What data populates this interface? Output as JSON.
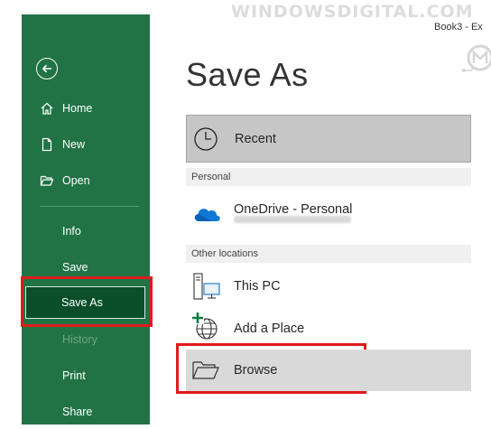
{
  "watermark": "WINDOWSDIGITAL.COM",
  "document_title": "Book3  -  Ex",
  "sidebar": {
    "items": [
      {
        "label": "Home"
      },
      {
        "label": "New"
      },
      {
        "label": "Open"
      },
      {
        "label": "Info"
      },
      {
        "label": "Save"
      },
      {
        "label": "Save As"
      },
      {
        "label": "History"
      },
      {
        "label": "Print"
      },
      {
        "label": "Share"
      }
    ]
  },
  "main": {
    "title": "Save As",
    "recent_label": "Recent",
    "personal_header": "Personal",
    "onedrive_label": "OneDrive - Personal",
    "other_header": "Other locations",
    "this_pc_label": "This PC",
    "add_place_label": "Add a Place",
    "browse_label": "Browse"
  },
  "colors": {
    "sidebar": "#217346",
    "selected": "#0b4f2a",
    "highlight_border": "#e01b1b",
    "onedrive": "#0f78d4"
  }
}
